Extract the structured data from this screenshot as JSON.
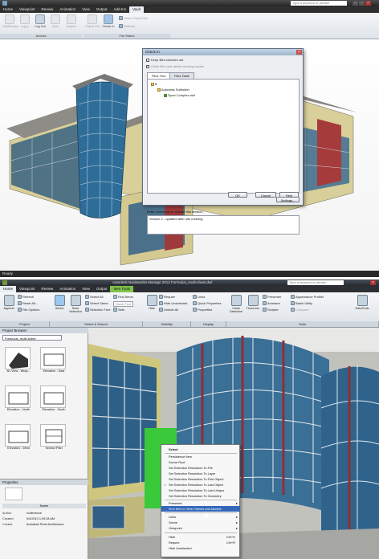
{
  "top_app": {
    "search_placeholder": "Type a keyword or phrase",
    "menu_tabs": [
      "Home",
      "Viewpoint",
      "Review",
      "Animation",
      "View",
      "Output",
      "Add-Ins",
      "Vault"
    ],
    "active_tab": "Vault",
    "ribbon_buttons": [
      {
        "label": "Get/Browse",
        "enabled": false
      },
      {
        "label": "Log In",
        "enabled": false
      },
      {
        "label": "Log Out",
        "enabled": true
      },
      {
        "label": "Open",
        "enabled": false
      },
      {
        "label": "Acquire",
        "enabled": false
      },
      {
        "label": "Check Out",
        "enabled": false
      },
      {
        "label": "Check In",
        "enabled": true
      },
      {
        "label": "Undo Check Out",
        "enabled": false
      },
      {
        "label": "Refresh",
        "enabled": false
      }
    ],
    "panels": [
      "Access",
      "File Status"
    ],
    "status": "Ready",
    "dialog": {
      "title": "Check In",
      "option1": "Keep files checked out",
      "option2": "Close files and delete working copies",
      "tabs": [
        "Files Tree",
        "Files Table"
      ],
      "tree": [
        "$",
        "Autodesk Subfolder",
        "Sport Complex.nwf"
      ],
      "settings_button": "Settings...",
      "comment_label": "Enter comments to include this version:",
      "comment_text": "Version 2 - updated after site meeting",
      "buttons": [
        "OK",
        "Cancel",
        "Help"
      ]
    }
  },
  "bottom_app": {
    "title": "Autodesk Navisworks Manage 2012   Formulus_multi-sheet.dwf",
    "search_placeholder": "Type a keyword or phrase",
    "menu_tabs": [
      "Home",
      "Viewpoint",
      "Review",
      "Animation",
      "View",
      "Output",
      "Item Tools"
    ],
    "active_tab": "Home",
    "contextual_tab": "Item Tools",
    "ribbon": {
      "project": [
        "Append",
        "Refresh",
        "Reset All...",
        "File Options"
      ],
      "select": [
        "Select",
        "Save Selection",
        "Select All",
        "Select Same",
        "Selection Tree",
        "Find Items",
        "Quick Find",
        "Sets"
      ],
      "visibility": [
        "Hide",
        "Require",
        "Hide Unselected",
        "Unhide All"
      ],
      "display": [
        "Links",
        "Quick Properties",
        "Properties"
      ],
      "tools": [
        "Clash Detective",
        "TimeLiner",
        "Presenter",
        "Animator",
        "Scripter",
        "Appearance Profiler",
        "Batch Utility",
        "Compare",
        "DataTools"
      ],
      "panels": [
        "Project",
        "Select & Search",
        "Visibility",
        "Display",
        "Tools"
      ]
    },
    "project_browser": {
      "title": "Project Browser",
      "combo": "Formulus_multi-sheet",
      "sheets": [
        "3D View - Wrap...",
        "Elevation - East",
        "Elevation - North",
        "Elevation - South",
        "Elevation - West",
        "Section Plan"
      ]
    },
    "properties": {
      "title": "Properties",
      "item": "Name",
      "rows": [
        {
          "key": "Author",
          "value": "nvilleneuve"
        },
        {
          "key": "Created",
          "value": "9/4/2010 1:09:28 AM"
        },
        {
          "key": "Creator",
          "value": "Autodesk Revit Architecture"
        }
      ]
    },
    "context_menu": [
      {
        "label": "Select",
        "bold": true
      },
      {
        "sep": true
      },
      {
        "label": "Persistence Item"
      },
      {
        "label": "Scene Root"
      },
      {
        "label": "Set Selection Resolution To File"
      },
      {
        "label": "Set Selection Resolution To Layer"
      },
      {
        "label": "Set Selection Resolution To First Object"
      },
      {
        "label": "Set Selection Resolution To Last Object"
      },
      {
        "label": "Set Selection Resolution To Last Unique"
      },
      {
        "label": "Set Selection Resolution To Geometry"
      },
      {
        "sep": true
      },
      {
        "label": "Presenter",
        "submenu": true
      },
      {
        "label": "Find Item in Other Sheets and Models",
        "highlighted": true
      },
      {
        "sep": true
      },
      {
        "label": "Links",
        "submenu": true
      },
      {
        "label": "Scene",
        "submenu": true
      },
      {
        "label": "Viewpoint",
        "submenu": true
      },
      {
        "sep": true
      },
      {
        "label": "Hide",
        "shortcut": "Ctrl+H"
      },
      {
        "label": "Require",
        "shortcut": "Ctrl+R"
      },
      {
        "label": "Hide Unselected"
      }
    ]
  }
}
